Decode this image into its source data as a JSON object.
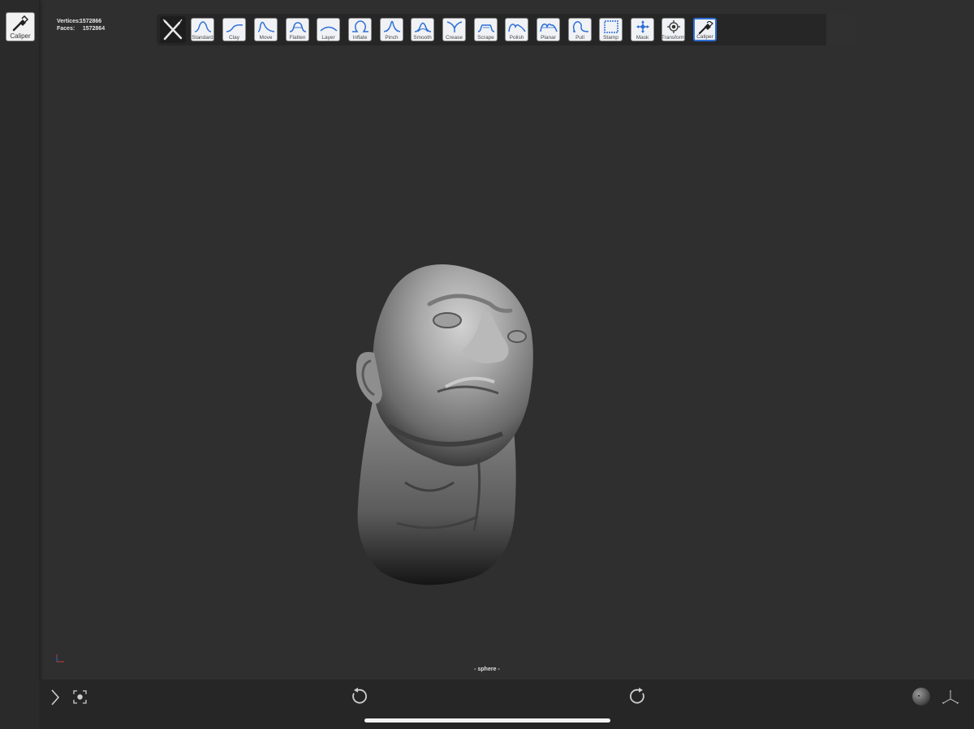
{
  "sidebar": {
    "active_tool_label": "Caliper",
    "active_tool_icon": "caliper-icon"
  },
  "stats": {
    "vertices_label": "Vertices:",
    "vertices_value": "1572866",
    "faces_label": "Faces:",
    "faces_value": "1572864"
  },
  "toolbar": {
    "menu_icon": "brush-menu-icon",
    "tools": [
      {
        "label": "Standard",
        "icon": "standard-brush-icon"
      },
      {
        "label": "Clay",
        "icon": "clay-brush-icon"
      },
      {
        "label": "Move",
        "icon": "move-brush-icon"
      },
      {
        "label": "Flatten",
        "icon": "flatten-brush-icon"
      },
      {
        "label": "Layer",
        "icon": "layer-brush-icon"
      },
      {
        "label": "Inflate",
        "icon": "inflate-brush-icon"
      },
      {
        "label": "Pinch",
        "icon": "pinch-brush-icon"
      },
      {
        "label": "Smooth",
        "icon": "smooth-brush-icon"
      },
      {
        "label": "Crease",
        "icon": "crease-brush-icon"
      },
      {
        "label": "Scrape",
        "icon": "scrape-brush-icon"
      },
      {
        "label": "Polish",
        "icon": "polish-brush-icon"
      },
      {
        "label": "Planar",
        "icon": "planar-brush-icon"
      },
      {
        "label": "Pull",
        "icon": "pull-brush-icon"
      },
      {
        "label": "Stamp",
        "icon": "stamp-brush-icon"
      },
      {
        "label": "Mask",
        "icon": "mask-brush-icon"
      },
      {
        "label": "Transform",
        "icon": "transform-icon"
      },
      {
        "label": "Caliper",
        "icon": "caliper-icon",
        "selected": true
      }
    ]
  },
  "viewport": {
    "mesh_name": "- sphere -"
  },
  "bottombar": {
    "icons": [
      "expand-chevron-icon",
      "frame-camera-icon",
      "undo-icon",
      "redo-icon",
      "matcap-sphere-icon",
      "axis-gizmo-icon"
    ]
  },
  "colors": {
    "accent": "#2f6fd6",
    "background": "#2f2f2f",
    "bar": "#262626"
  }
}
